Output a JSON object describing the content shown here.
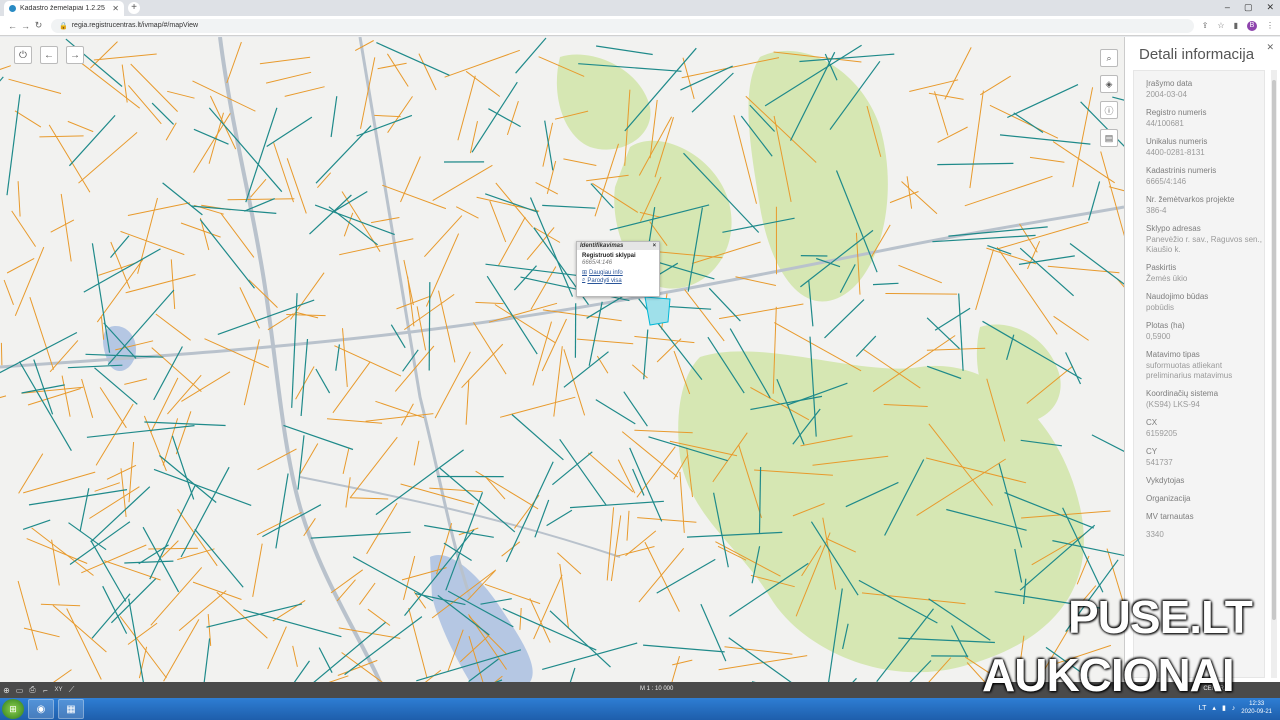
{
  "browser": {
    "tab_title": "Kadastro žemėlapiai 1.2.25",
    "url": "regia.registrucentras.lt/ivmap/#/mapView",
    "profile_initial": "B"
  },
  "map": {
    "scale": "M 1 : 10 000",
    "attribution": "CENTRAS",
    "popup": {
      "header": "Identifikavimas",
      "title": "Registruoti sklypai",
      "number": "6665/4:146",
      "link_info": "Daugiau info",
      "link_show": "Parodyti visa"
    },
    "colors": {
      "teal": "#1f8a8a",
      "orange": "#e89a2c",
      "green": "#d6e7b3",
      "water": "#b5c7e3",
      "road": "#b9c2cc"
    }
  },
  "panel": {
    "title": "Detali informacija",
    "fields": [
      {
        "label": "Įrašymo data",
        "value": "2004-03-04"
      },
      {
        "label": "Registro numeris",
        "value": "44/100681"
      },
      {
        "label": "Unikalus numeris",
        "value": "4400-0281-8131"
      },
      {
        "label": "Kadastrinis numeris",
        "value": "6665/4:146"
      },
      {
        "label": "Nr. žemėtvarkos projekte",
        "value": "386-4"
      },
      {
        "label": "Sklypo adresas",
        "value": "Panevėžio r. sav., Raguvos sen., Kiaušio k."
      },
      {
        "label": "Paskirtis",
        "value": "Žemės ūkio"
      },
      {
        "label": "Naudojimo būdas",
        "value": "pobūdis"
      },
      {
        "label": "Plotas (ha)",
        "value": "0,5900"
      },
      {
        "label": "Matavimo tipas",
        "value": "suformuotas atliekant preliminarius matavimus"
      },
      {
        "label": "Koordinačių sistema",
        "value": "(KS94) LKS-94"
      },
      {
        "label": "CX",
        "value": "6159205"
      },
      {
        "label": "CY",
        "value": "541737"
      },
      {
        "label": "Vykdytojas",
        "value": ""
      },
      {
        "label": "Organizacija",
        "value": ""
      },
      {
        "label": "MV tarnautas",
        "value": ""
      },
      {
        "label": "",
        "value": "3340"
      }
    ]
  },
  "statusbar": {
    "xy_label": "XY"
  },
  "taskbar": {
    "lang": "LT",
    "time": "12:33",
    "date": "2020-09-21"
  },
  "watermark": {
    "line1": "PUSE.LT",
    "line2": "AUKCIONAI"
  }
}
